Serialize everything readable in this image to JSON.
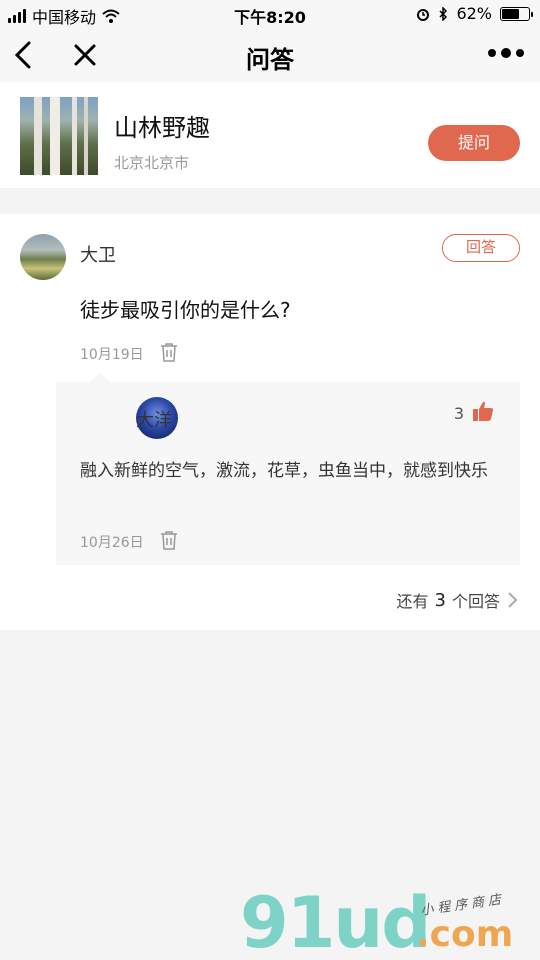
{
  "status_bar": {
    "carrier": "中国移动",
    "time": "下午8:20",
    "battery": "62%"
  },
  "nav": {
    "title": "问答"
  },
  "topic": {
    "name": "山林野趣",
    "location": "北京北京市",
    "ask_label": "提问"
  },
  "question": {
    "asker": "大卫",
    "answer_label": "回答",
    "text": "徒步最吸引你的是什么?",
    "date": "10月19日"
  },
  "reply": {
    "author": "大洋",
    "likes": "3",
    "text": "融入新鲜的空气，激流，花草，虫鱼当中，就感到快乐",
    "date": "10月26日"
  },
  "more": {
    "prefix": "还有",
    "count": "3",
    "suffix": "个回答"
  },
  "watermark": {
    "logo": "91ud",
    "domain": ".com",
    "tagline": "小程序商店"
  }
}
